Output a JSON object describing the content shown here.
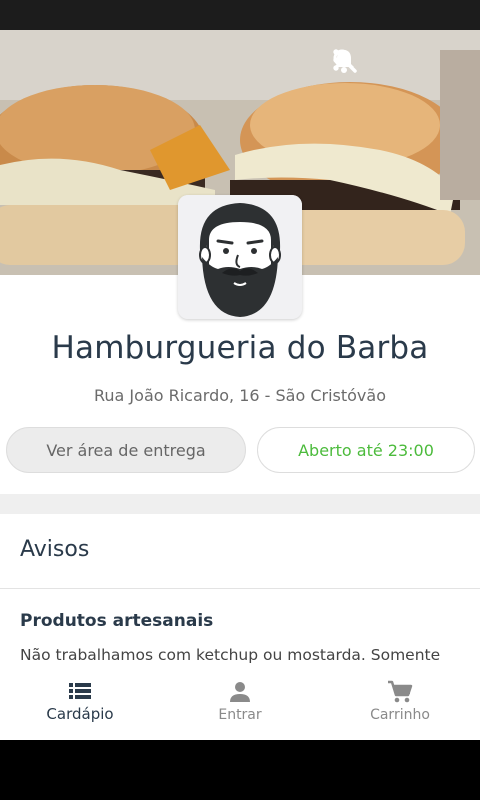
{
  "restaurant": {
    "name": "Hamburgueria do Barba",
    "address": "Rua João Ricardo, 16 - São Cristóvão"
  },
  "buttons": {
    "delivery_area": "Ver área de entrega",
    "open_status": "Aberto até 23:00"
  },
  "notices": {
    "title": "Avisos",
    "items": [
      {
        "title": "Produtos artesanais",
        "text": "Não trabalhamos com ketchup ou mostarda. Somente"
      }
    ]
  },
  "icons": {
    "notifications": "bell-icon",
    "search": "search-icon",
    "more": "more-vertical-icon"
  },
  "nav": {
    "items": [
      {
        "label": "Cardápio",
        "icon": "menu-list-icon"
      },
      {
        "label": "Entrar",
        "icon": "person-icon"
      },
      {
        "label": "Carrinho",
        "icon": "cart-icon"
      }
    ]
  },
  "colors": {
    "title": "#2a3a4a",
    "open_green": "#4cbb3c",
    "inactive": "#8a8a8a"
  }
}
